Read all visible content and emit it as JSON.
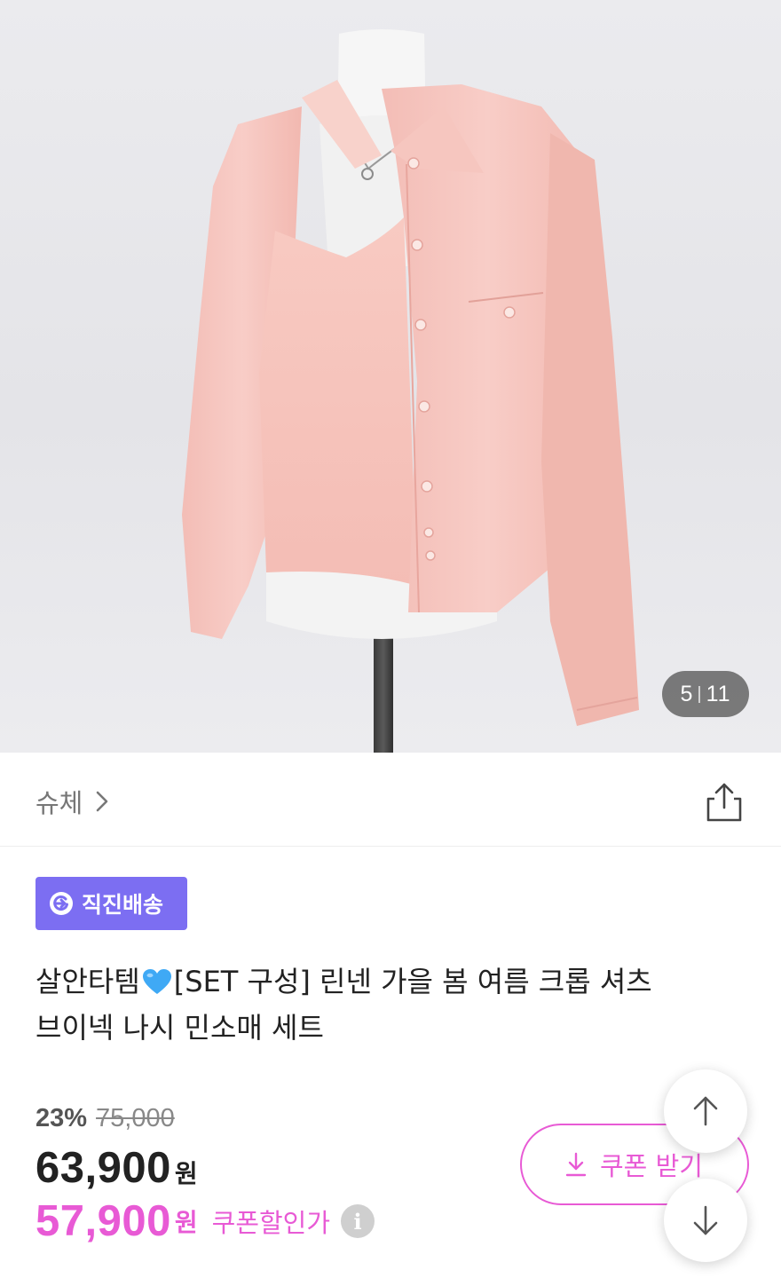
{
  "gallery": {
    "current": "5",
    "total": "11",
    "image_alt": "pink linen shirt and sleeveless top set on mannequin"
  },
  "shop": {
    "name": "슈체"
  },
  "badge": {
    "label": "직진배송",
    "color": "#7c6ef2"
  },
  "product": {
    "title_line1_prefix": "살안타템",
    "title_line1_suffix": "[SET 구성] 린넨 가을 봄 여름 크롭 셔츠",
    "title_line2": "브이넥 나시 민소매 세트"
  },
  "price": {
    "discount_rate": "23%",
    "original": "75,000",
    "sale": "63,900",
    "sale_unit": "원",
    "coupon_price": "57,900",
    "coupon_unit": "원",
    "coupon_label": "쿠폰할인가",
    "info_glyph": "i"
  },
  "coupon_button": {
    "label": "쿠폰 받기"
  },
  "colors": {
    "accent": "#e85ad5",
    "badge": "#7c6ef2"
  },
  "icons": [
    "share-icon",
    "chevron-right-icon",
    "delivery-icon",
    "blue-heart-icon",
    "download-icon",
    "arrow-up-icon",
    "arrow-down-icon",
    "info-icon"
  ]
}
